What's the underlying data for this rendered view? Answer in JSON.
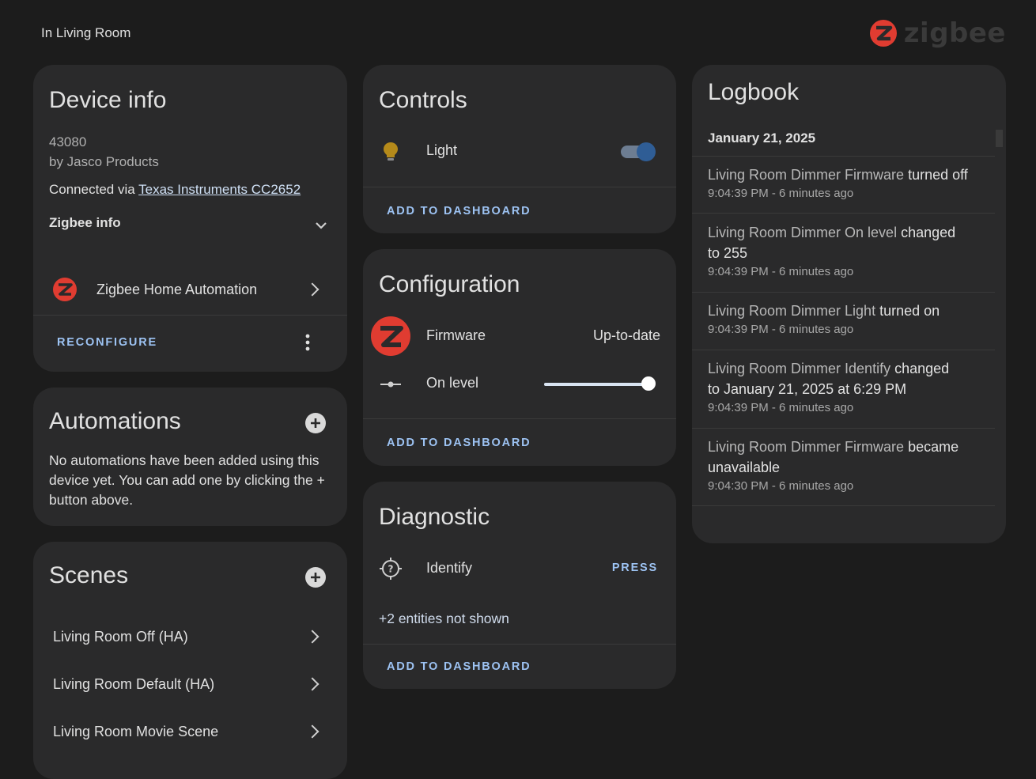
{
  "page": {
    "area": "In Living Room"
  },
  "brand": {
    "name": "zigbee",
    "color": "#e03c31"
  },
  "device_info": {
    "title": "Device info",
    "model": "43080",
    "manufacturer": "by Jasco Products",
    "connected_prefix": "Connected via ",
    "connected_link": "Texas Instruments CC2652",
    "zigbee_info": "Zigbee info",
    "integration": "Zigbee Home Automation",
    "reconfigure": "RECONFIGURE"
  },
  "automations": {
    "title": "Automations",
    "empty_text": "No automations have been added using this device yet. You can add one by clicking the + button above."
  },
  "scenes": {
    "title": "Scenes",
    "items": [
      {
        "label": "Living Room Off (HA)"
      },
      {
        "label": "Living Room Default (HA)"
      },
      {
        "label": "Living Room Movie Scene"
      }
    ]
  },
  "controls": {
    "title": "Controls",
    "light_label": "Light",
    "light_on": true,
    "add_to_dashboard": "ADD TO DASHBOARD"
  },
  "configuration": {
    "title": "Configuration",
    "firmware_label": "Firmware",
    "firmware_state": "Up-to-date",
    "on_level_label": "On level",
    "on_level_value": 1.0,
    "add_to_dashboard": "ADD TO DASHBOARD"
  },
  "diagnostic": {
    "title": "Diagnostic",
    "identify_label": "Identify",
    "press": "PRESS",
    "hidden_entities": "+2 entities not shown",
    "add_to_dashboard": "ADD TO DASHBOARD"
  },
  "logbook": {
    "title": "Logbook",
    "date": "January 21, 2025",
    "entries": [
      {
        "entity": "Living Room Dimmer Firmware",
        "action": "turned off",
        "time": "9:04:39 PM - 6 minutes ago"
      },
      {
        "entity": "Living Room Dimmer On level",
        "action": "changed to 255",
        "time": "9:04:39 PM - 6 minutes ago"
      },
      {
        "entity": "Living Room Dimmer Light",
        "action": "turned on",
        "time": "9:04:39 PM - 6 minutes ago"
      },
      {
        "entity": "Living Room Dimmer Identify",
        "action": "changed to January 21, 2025 at 6:29 PM",
        "time": "9:04:39 PM - 6 minutes ago"
      },
      {
        "entity": "Living Room Dimmer Firmware",
        "action": "became unavailable",
        "time": "9:04:30 PM - 6 minutes ago"
      }
    ]
  }
}
